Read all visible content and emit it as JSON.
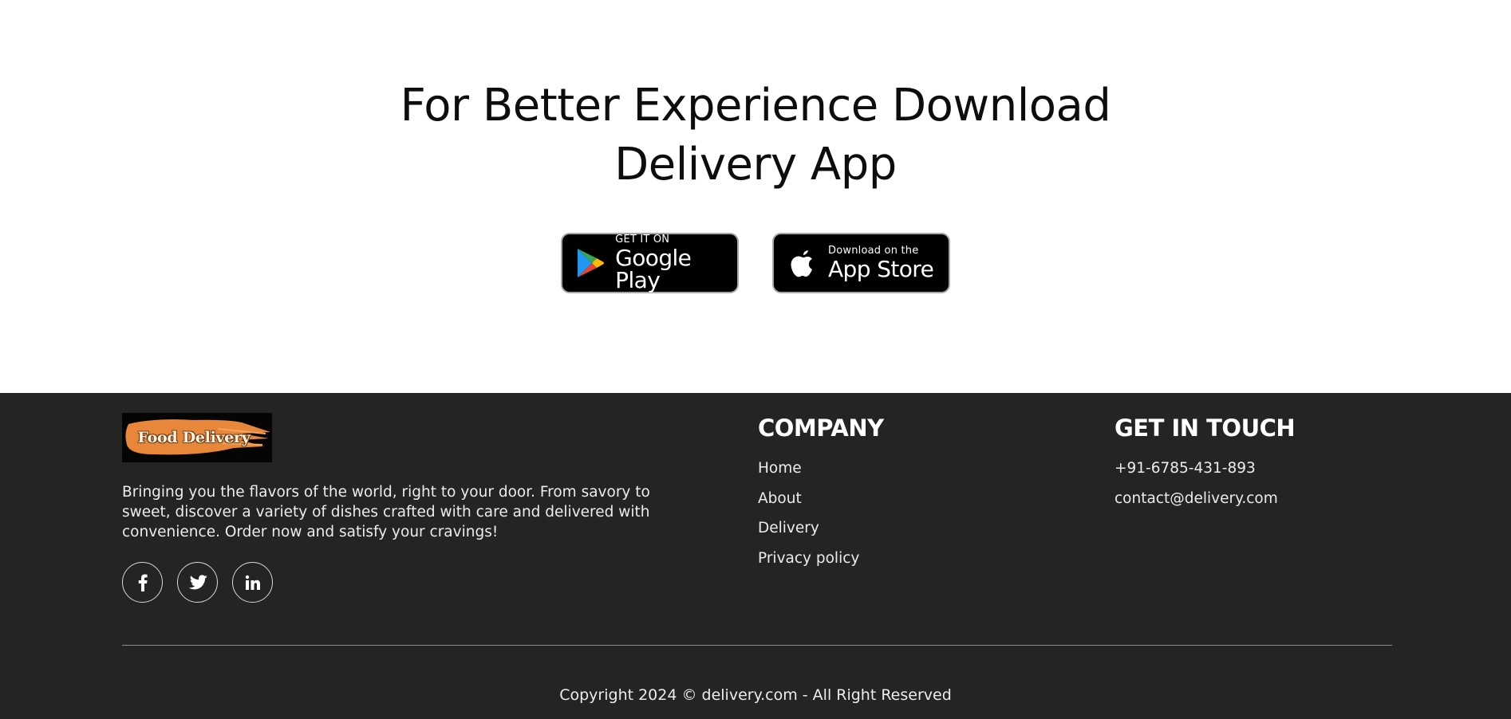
{
  "app_promo": {
    "title_line1": "For Better Experience Download",
    "title_line2": "Delivery App",
    "google_play": {
      "small_text": "GET IT ON",
      "big_text": "Google Play",
      "icon": "google-play-icon"
    },
    "app_store": {
      "small_text": "Download on the",
      "big_text": "App Store",
      "icon": "apple-icon"
    }
  },
  "footer": {
    "logo_text": "Food Delivery",
    "about": "Bringing you the flavors of the world, right to your door. From savory to sweet, discover a variety of dishes crafted with care and delivered with convenience. Order now and satisfy your cravings!",
    "socials": [
      {
        "icon": "facebook-icon"
      },
      {
        "icon": "twitter-icon"
      },
      {
        "icon": "linkedin-icon"
      }
    ],
    "company": {
      "heading": "COMPANY",
      "links": [
        "Home",
        "About",
        "Delivery",
        "Privacy policy"
      ]
    },
    "contact": {
      "heading": "GET IN TOUCH",
      "phone": "+91-6785-431-893",
      "email": "contact@delivery.com"
    },
    "copyright": "Copyright 2024 © delivery.com - All Right Reserved"
  },
  "colors": {
    "footer_bg": "#242424",
    "logo_orange": "#e8873a",
    "badge_bg": "#000000"
  }
}
